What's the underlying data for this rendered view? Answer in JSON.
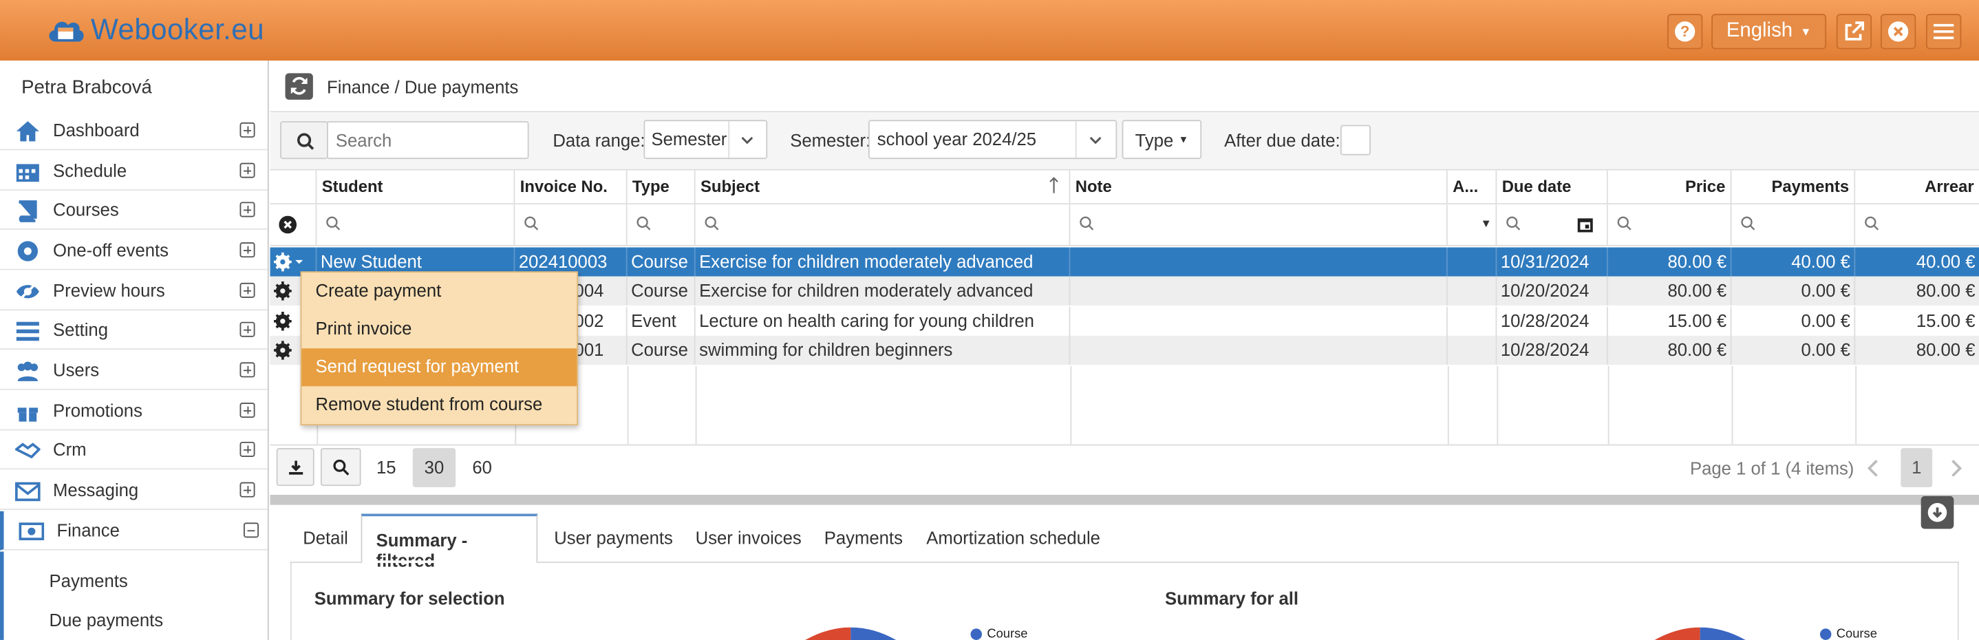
{
  "header": {
    "logo_text": "Webooker.eu",
    "language": "English",
    "brand_color": "#e8873e"
  },
  "sidebar": {
    "user_name": "Petra Brabcová",
    "items": [
      {
        "label": "Dashboard",
        "icon": "home-icon"
      },
      {
        "label": "Schedule",
        "icon": "calendar-icon"
      },
      {
        "label": "Courses",
        "icon": "book-icon"
      },
      {
        "label": "One-off events",
        "icon": "ball-icon"
      },
      {
        "label": "Preview hours",
        "icon": "eye-icon"
      },
      {
        "label": "Setting",
        "icon": "settings-icon"
      },
      {
        "label": "Users",
        "icon": "users-icon"
      },
      {
        "label": "Promotions",
        "icon": "gift-icon"
      },
      {
        "label": "Crm",
        "icon": "handshake-icon"
      },
      {
        "label": "Messaging",
        "icon": "envelope-icon"
      },
      {
        "label": "Finance",
        "icon": "money-icon"
      }
    ],
    "finance_sub": [
      "Payments",
      "Due payments"
    ]
  },
  "breadcrumb": "Finance / Due payments",
  "toolbar": {
    "search_placeholder": "Search",
    "data_range_label": "Data range:",
    "data_range_value": "Semester",
    "semester_label": "Semester:",
    "semester_value": "school year 2024/25",
    "type_button": "Type",
    "after_due_label": "After due date:"
  },
  "grid": {
    "columns": [
      "Student",
      "Invoice No.",
      "Type",
      "Subject",
      "Note",
      "A...",
      "Due date",
      "Price",
      "Payments",
      "Arrear"
    ],
    "rows": [
      {
        "student": "New Student",
        "invoice": "202410003",
        "type": "Course",
        "subject": "Exercise for children moderately advanced",
        "note": "",
        "a": "",
        "due": "10/31/2024",
        "price": "80.00 €",
        "payments": "40.00 €",
        "arrear": "40.00 €"
      },
      {
        "student": "",
        "invoice": "004",
        "type": "Course",
        "subject": "Exercise for children moderately advanced",
        "note": "",
        "a": "",
        "due": "10/20/2024",
        "price": "80.00 €",
        "payments": "0.00 €",
        "arrear": "80.00 €"
      },
      {
        "student": "",
        "invoice": "002",
        "type": "Event",
        "subject": "Lecture on health caring for young children",
        "note": "",
        "a": "",
        "due": "10/28/2024",
        "price": "15.00 €",
        "payments": "0.00 €",
        "arrear": "15.00 €"
      },
      {
        "student": "",
        "invoice": "001",
        "type": "Course",
        "subject": "swimming for children beginners",
        "note": "",
        "a": "",
        "due": "10/28/2024",
        "price": "80.00 €",
        "payments": "0.00 €",
        "arrear": "80.00 €"
      }
    ]
  },
  "context_menu": [
    "Create payment",
    "Print invoice",
    "Send request for payment",
    "Remove student from course"
  ],
  "pager": {
    "sizes": [
      "15",
      "30",
      "60"
    ],
    "selected_size": "30",
    "info": "Page 1 of 1 (4 items)",
    "current_page": "1"
  },
  "tabs": [
    "Detail",
    "Summary - filtered",
    "User payments",
    "User invoices",
    "Payments",
    "Amortization schedule"
  ],
  "active_tab": "Summary - filtered",
  "summary": {
    "left_title": "Summary for selection",
    "right_title": "Summary for all",
    "legend_course": "Course"
  }
}
